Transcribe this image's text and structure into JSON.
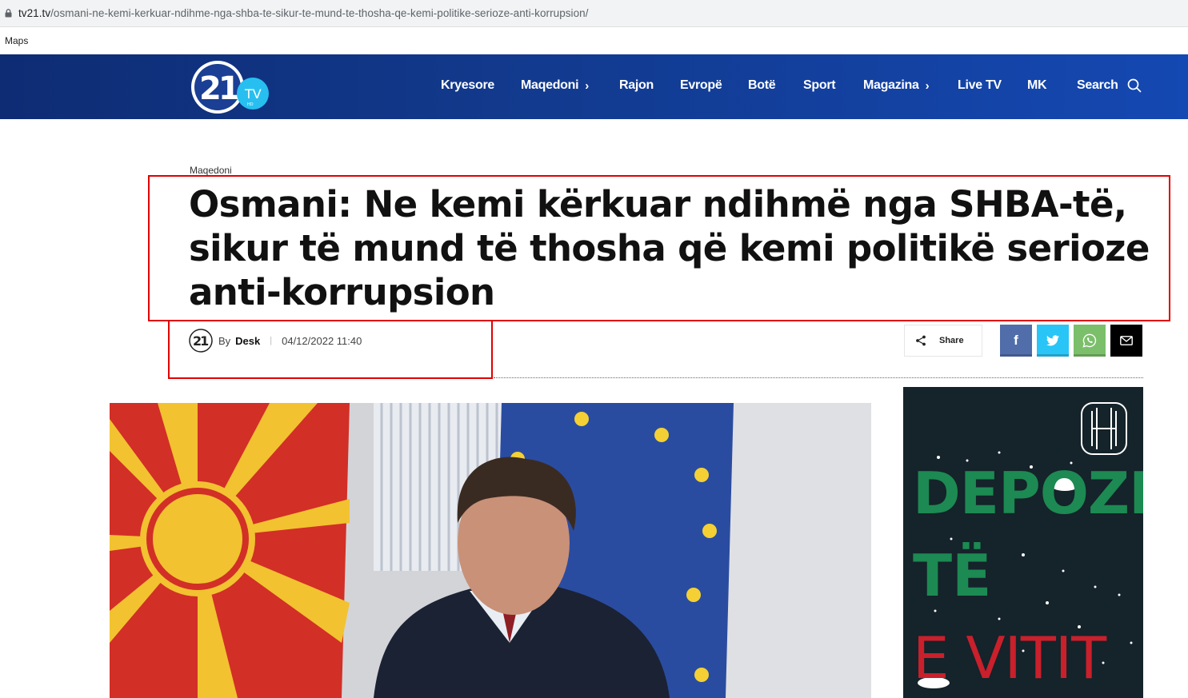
{
  "browser": {
    "url_host": "tv21.tv",
    "url_path": "/osmani-ne-kemi-kerkuar-ndihme-nga-shba-te-sikur-te-mund-te-thosha-qe-kemi-politike-serioze-anti-korrupsion/",
    "bookmarks": [
      "Maps"
    ]
  },
  "header": {
    "logo_number": "21",
    "logo_tv": "TV",
    "logo_hd": "HD",
    "nav": [
      {
        "label": "Kryesore"
      },
      {
        "label": "Maqedoni",
        "chevron": "›"
      },
      {
        "label": "Rajon"
      },
      {
        "label": "Evropë"
      },
      {
        "label": "Botë"
      },
      {
        "label": "Sport"
      },
      {
        "label": "Magazina",
        "chevron": "›"
      },
      {
        "label": "Live TV"
      },
      {
        "label": "MK"
      }
    ],
    "search_label": "Search"
  },
  "article": {
    "category": "Maqedoni",
    "title": "Osmani: Ne kemi kërkuar ndihmë nga SHBA-të, sikur të mund të thosha që kemi politikë serioze anti-korrupsion",
    "by_label": "By",
    "author": "Desk",
    "separator": "|",
    "date": "04/12/2022 11:40",
    "share_label": "Share",
    "share_buttons": [
      {
        "name": "facebook",
        "color": "#516eab",
        "glyph": "f"
      },
      {
        "name": "twitter",
        "color": "#29c5f6",
        "glyph": "twitter-bird"
      },
      {
        "name": "whatsapp",
        "color": "#7bbf6a",
        "glyph": "whatsapp"
      },
      {
        "name": "email",
        "color": "#000000",
        "glyph": "envelope"
      }
    ]
  },
  "ad": {
    "line1": "DEPOZI",
    "line2": "TË",
    "line3": "E VITIT",
    "brand_color": "#1c8a52",
    "accent_color": "#c9202c"
  },
  "colors": {
    "header_start": "#0e2c74",
    "header_end": "#1448b2",
    "highlight_box": "#e00000"
  }
}
